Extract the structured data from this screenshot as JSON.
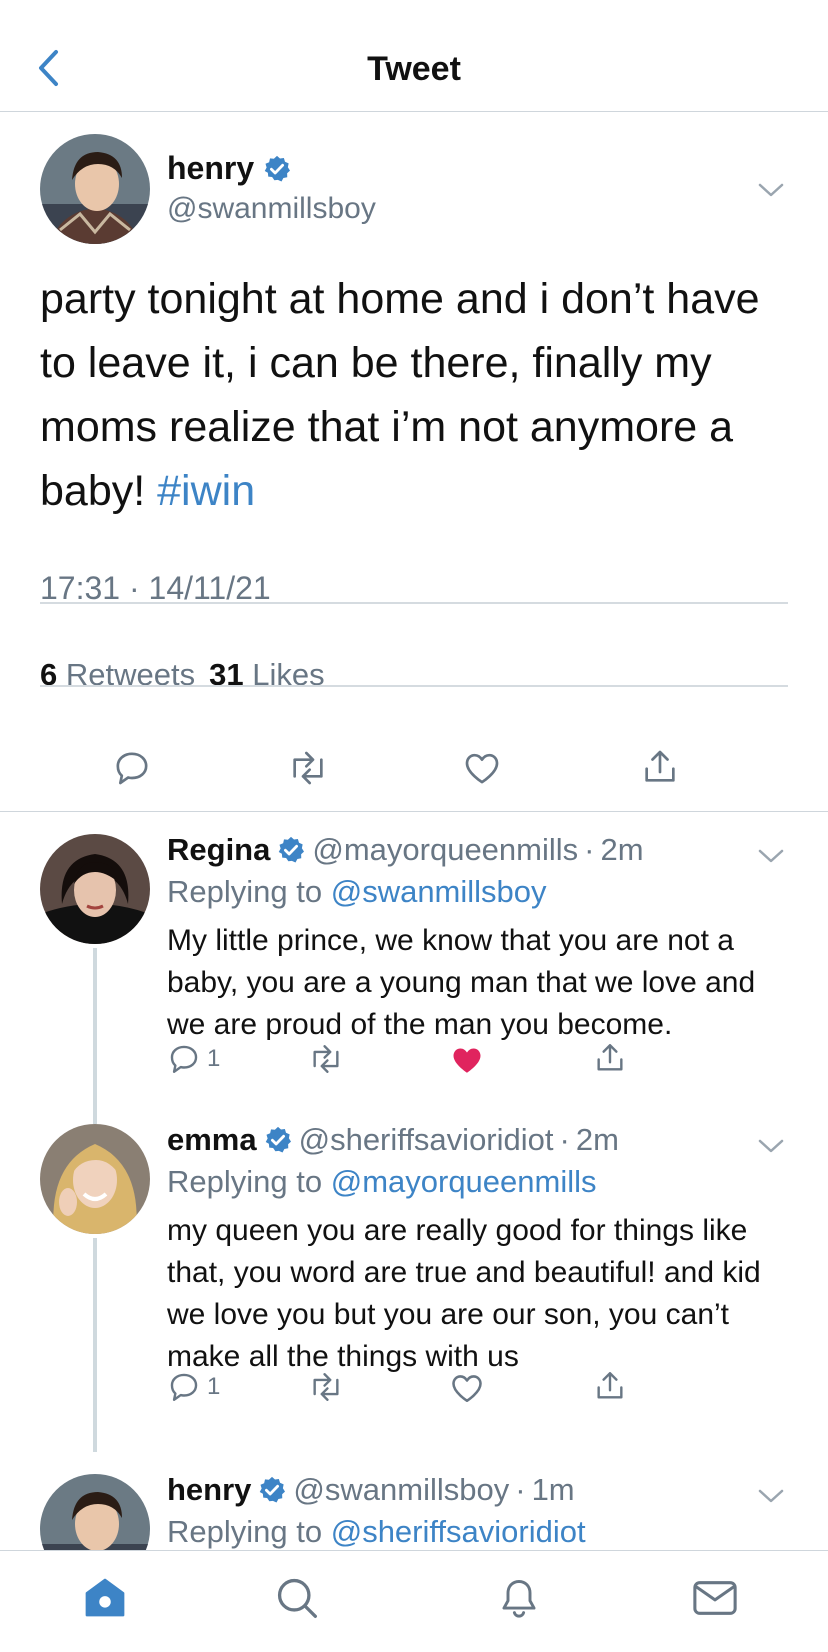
{
  "header": {
    "title": "Tweet"
  },
  "main_tweet": {
    "name": "henry",
    "handle": "@swanmillsboy",
    "text": "party tonight at home and i don’t have to leave it, i can be there, finally my moms realize that i’m not anymore a baby! ",
    "hashtag": "#iwin",
    "timestamp": "17:31 · 14/11/21",
    "retweets_count": "6",
    "retweets_label": "Retweets",
    "likes_count": "31",
    "likes_label": "Likes"
  },
  "replies": [
    {
      "name": "Regina",
      "handle": "@mayorqueenmills",
      "separator": "·",
      "time": "2m",
      "replying_prefix": "Replying to",
      "replying_to": "@swanmillsboy",
      "text": "My little prince, we know that you are not a baby, you are a young man that we love and we are proud of the man you become.",
      "reply_count": "1",
      "liked": true
    },
    {
      "name": "emma",
      "handle": "@sheriffsavioridiot",
      "separator": "·",
      "time": "2m",
      "replying_prefix": "Replying to",
      "replying_to": "@mayorqueenmills",
      "text": "my queen you are really good for things like that, you word are true and beautiful! and kid we love you but you are our son, you can’t make all the things with us",
      "reply_count": "1",
      "liked": false
    },
    {
      "name": "henry",
      "handle": "@swanmillsboy",
      "separator": "·",
      "time": "1m",
      "replying_prefix": "Replying to",
      "replying_to": "@sheriffsavioridiot"
    }
  ],
  "colors": {
    "accent": "#3d84c6",
    "verified": "#3d84c6",
    "like_red": "#e0245e",
    "muted": "#687684"
  },
  "tabbar": {
    "items": [
      "home-icon",
      "search-icon",
      "notifications-icon",
      "messages-icon"
    ],
    "active": "home-icon"
  }
}
